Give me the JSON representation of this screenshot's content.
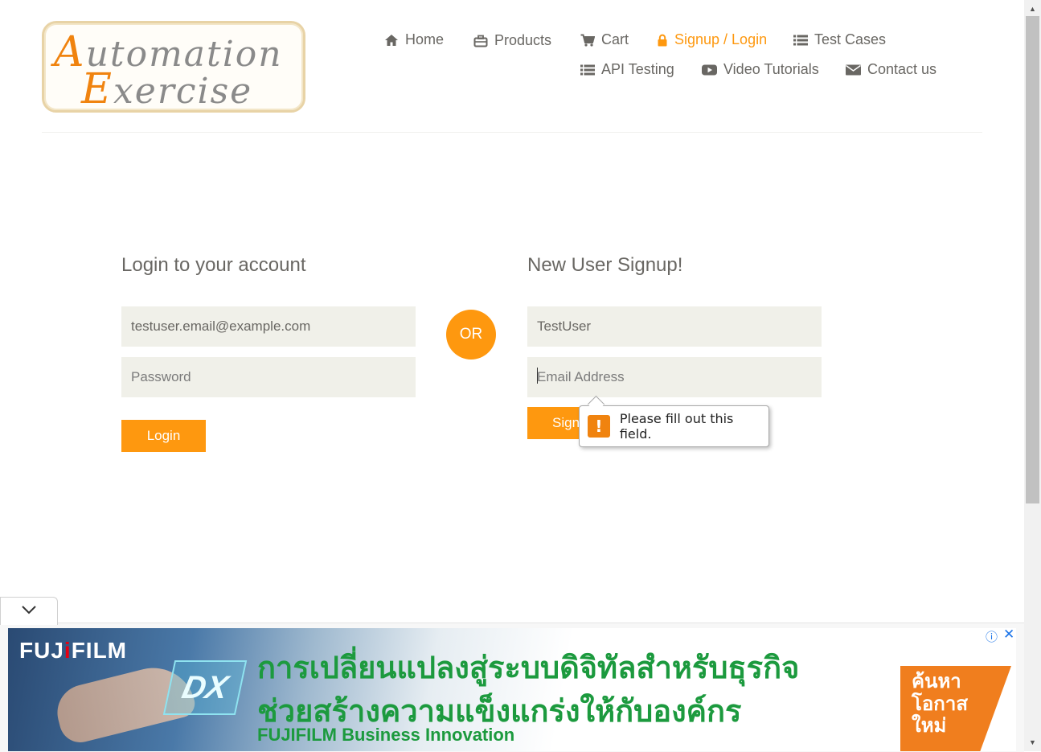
{
  "logo": {
    "line1_cap": "A",
    "line1_rest": "utomation",
    "line2_cap": "E",
    "line2_rest": "xercise"
  },
  "nav": {
    "home": "Home",
    "products": "Products",
    "cart": "Cart",
    "signup_login": "Signup / Login",
    "test_cases": "Test Cases",
    "api_testing": "API Testing",
    "video_tutorials": "Video Tutorials",
    "contact_us": "Contact us"
  },
  "login": {
    "title": "Login to your account",
    "email_value": "testuser.email@example.com",
    "password_placeholder": "Password",
    "button": "Login"
  },
  "or_label": "OR",
  "signup": {
    "title": "New User Signup!",
    "name_value": "TestUser",
    "email_placeholder": "Email Address",
    "button": "Signup"
  },
  "validation": {
    "icon": "!",
    "message": "Please fill out this field."
  },
  "ad": {
    "brand_pre": "FUJ",
    "brand_i": "i",
    "brand_post": "FILM",
    "dx": "DX",
    "headline1": "การเปลี่ยนแปลงสู่ระบบดิจิทัลสำหรับธุรกิจ",
    "headline2": "ช่วยสร้างความแข็งแกร่งให้กับองค์กร",
    "subline": "FUJIFILM Business Innovation",
    "cta_line1": "ค้นหา",
    "cta_line2": "โอกาส",
    "cta_line3": "ใหม่",
    "info": "ⓘ",
    "close": "✕"
  },
  "colors": {
    "accent": "#fe980f",
    "text": "#696763",
    "field_bg": "#f0f0e9",
    "ad_green": "#1c9a3e",
    "ad_orange": "#f07e1e"
  }
}
